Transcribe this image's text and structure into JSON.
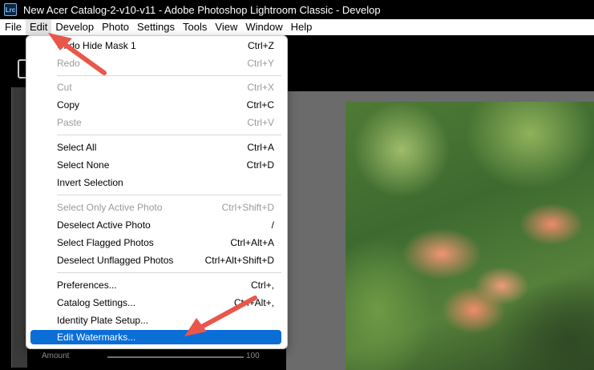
{
  "window": {
    "title": "New Acer Catalog-2-v10-v11 - Adobe Photoshop Lightroom Classic - Develop",
    "app_icon_text": "Lrc"
  },
  "menubar": {
    "items": [
      "File",
      "Edit",
      "Develop",
      "Photo",
      "Settings",
      "Tools",
      "View",
      "Window",
      "Help"
    ],
    "active": "Edit"
  },
  "edit_menu": {
    "items": [
      {
        "label": "Undo Hide Mask 1",
        "shortcut": "Ctrl+Z",
        "enabled": true
      },
      {
        "label": "Redo",
        "shortcut": "Ctrl+Y",
        "enabled": false
      },
      {
        "label": "Cut",
        "shortcut": "Ctrl+X",
        "enabled": false
      },
      {
        "label": "Copy",
        "shortcut": "Ctrl+C",
        "enabled": true
      },
      {
        "label": "Paste",
        "shortcut": "Ctrl+V",
        "enabled": false
      },
      {
        "label": "Select All",
        "shortcut": "Ctrl+A",
        "enabled": true
      },
      {
        "label": "Select None",
        "shortcut": "Ctrl+D",
        "enabled": true
      },
      {
        "label": "Invert Selection",
        "shortcut": "",
        "enabled": true
      },
      {
        "label": "Select Only Active Photo",
        "shortcut": "Ctrl+Shift+D",
        "enabled": false
      },
      {
        "label": "Deselect Active Photo",
        "shortcut": "/",
        "enabled": true
      },
      {
        "label": "Select Flagged Photos",
        "shortcut": "Ctrl+Alt+A",
        "enabled": true
      },
      {
        "label": "Deselect Unflagged Photos",
        "shortcut": "Ctrl+Alt+Shift+D",
        "enabled": true
      },
      {
        "label": "Preferences...",
        "shortcut": "Ctrl+,",
        "enabled": true
      },
      {
        "label": "Catalog Settings...",
        "shortcut": "Ctrl+Alt+,",
        "enabled": true
      },
      {
        "label": "Identity Plate Setup...",
        "shortcut": "",
        "enabled": true
      },
      {
        "label": "Edit Watermarks...",
        "shortcut": "",
        "enabled": true,
        "highlighted": true
      }
    ]
  },
  "panel": {
    "amount_label": "Amount",
    "amount_value": "100"
  },
  "colors": {
    "highlight": "#0b6ed6",
    "annotation_arrow": "#e8574a"
  }
}
